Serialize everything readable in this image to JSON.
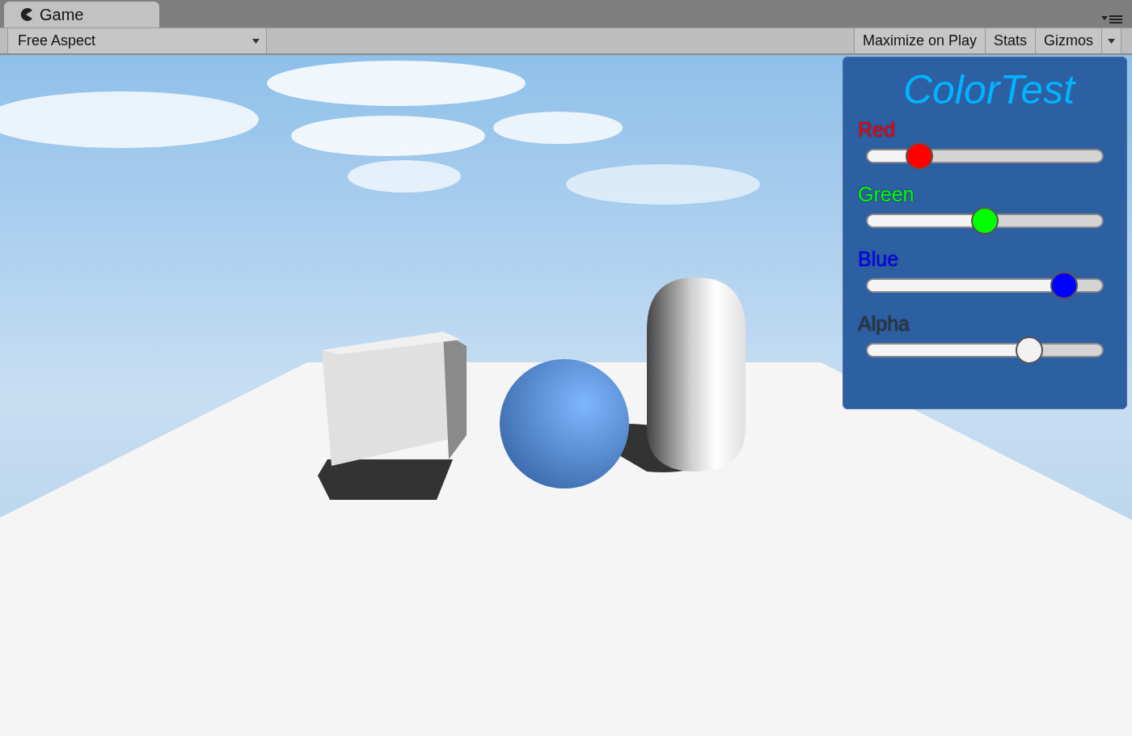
{
  "tab": {
    "label": "Game",
    "selected": true
  },
  "toolbar": {
    "aspect": {
      "value": "Free Aspect"
    },
    "buttons": [
      {
        "label": "Maximize on Play",
        "selected": false
      },
      {
        "label": "Stats",
        "selected": false
      },
      {
        "label": "Gizmos",
        "selected": false
      }
    ]
  },
  "panel": {
    "title": "ColorTest",
    "sliders": [
      {
        "label": "Red",
        "color": "#ff0000",
        "kind": "channel",
        "level": 0.19
      },
      {
        "label": "Green",
        "color": "#00ff00",
        "kind": "channel",
        "level": 0.5
      },
      {
        "label": "Blue",
        "color": "#0000ff",
        "kind": "channel",
        "level": 0.875
      },
      {
        "label": "Alpha",
        "color": "#333333",
        "kind": "alpha",
        "level": 0.71
      }
    ]
  }
}
